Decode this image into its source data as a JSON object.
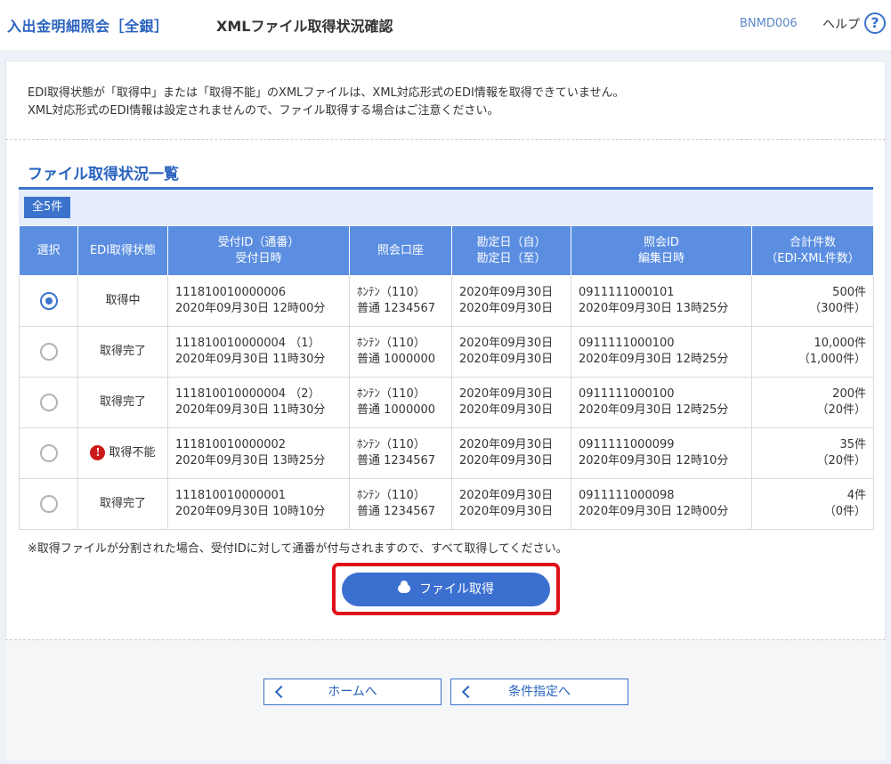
{
  "header": {
    "breadcrumb": "入出金明細照会［全銀］",
    "title": "XMLファイル取得状況確認",
    "screen_id": "BNMD006",
    "help_label": "ヘルプ",
    "help_icon": "?"
  },
  "notice": {
    "line1": "EDI取得状態が「取得中」または「取得不能」のXMLファイルは、XML対応形式のEDI情報を取得できていません。",
    "line2": "XML対応形式のEDI情報は設定されませんので、ファイル取得する場合はご注意ください。"
  },
  "section": {
    "title": "ファイル取得状況一覧",
    "count": "全5件"
  },
  "table": {
    "headers": [
      {
        "l1": "選択",
        "l2": ""
      },
      {
        "l1": "EDI取得状態",
        "l2": ""
      },
      {
        "l1": "受付ID（通番）",
        "l2": "受付日時"
      },
      {
        "l1": "照会口座",
        "l2": ""
      },
      {
        "l1": "勘定日（自）",
        "l2": "勘定日（至）"
      },
      {
        "l1": "照会ID",
        "l2": "編集日時"
      },
      {
        "l1": "合計件数",
        "l2": "（EDI-XML件数）"
      }
    ],
    "rows": [
      {
        "selected": true,
        "status": "取得中",
        "status_error": false,
        "receipt_id": "111810010000006",
        "receipt_dt": "2020年09月30日 12時00分",
        "branch": "ﾎﾝﾃﾝ（110）",
        "account": "普通 1234567",
        "date_from": "2020年09月30日",
        "date_to": "2020年09月30日",
        "inquiry_id": "0911111000101",
        "edit_dt": "2020年09月30日 13時25分",
        "total": "500件",
        "xml_count": "（300件）"
      },
      {
        "selected": false,
        "status": "取得完了",
        "status_error": false,
        "receipt_id": "111810010000004 （1）",
        "receipt_dt": "2020年09月30日 11時30分",
        "branch": "ﾎﾝﾃﾝ（110）",
        "account": "普通 1000000",
        "date_from": "2020年09月30日",
        "date_to": "2020年09月30日",
        "inquiry_id": "0911111000100",
        "edit_dt": "2020年09月30日 12時25分",
        "total": "10,000件",
        "xml_count": "（1,000件）"
      },
      {
        "selected": false,
        "status": "取得完了",
        "status_error": false,
        "receipt_id": "111810010000004 （2）",
        "receipt_dt": "2020年09月30日 11時30分",
        "branch": "ﾎﾝﾃﾝ（110）",
        "account": "普通 1000000",
        "date_from": "2020年09月30日",
        "date_to": "2020年09月30日",
        "inquiry_id": "0911111000100",
        "edit_dt": "2020年09月30日 12時25分",
        "total": "200件",
        "xml_count": "（20件）"
      },
      {
        "selected": false,
        "status": "取得不能",
        "status_error": true,
        "receipt_id": "111810010000002",
        "receipt_dt": "2020年09月30日 13時25分",
        "branch": "ﾎﾝﾃﾝ（110）",
        "account": "普通 1234567",
        "date_from": "2020年09月30日",
        "date_to": "2020年09月30日",
        "inquiry_id": "0911111000099",
        "edit_dt": "2020年09月30日 12時10分",
        "total": "35件",
        "xml_count": "（20件）"
      },
      {
        "selected": false,
        "status": "取得完了",
        "status_error": false,
        "receipt_id": "111810010000001",
        "receipt_dt": "2020年09月30日 10時10分",
        "branch": "ﾎﾝﾃﾝ（110）",
        "account": "普通 1234567",
        "date_from": "2020年09月30日",
        "date_to": "2020年09月30日",
        "inquiry_id": "0911111000098",
        "edit_dt": "2020年09月30日 12時00分",
        "total": "4件",
        "xml_count": "（0件）"
      }
    ]
  },
  "footnote": "※取得ファイルが分割された場合、受付IDに対して通番が付与されますので、すべて取得してください。",
  "actions": {
    "fetch_label": "ファイル取得",
    "home_label": "ホームへ",
    "conditions_label": "条件指定へ"
  },
  "icons": {
    "error": "!",
    "help": "question-circle-icon",
    "cloud": "cloud-download-icon",
    "back": "chevron-left-icon"
  },
  "colors": {
    "accent": "#3b73cc",
    "table_header": "#5b8ee0",
    "highlight": "#e0101a",
    "error": "#cc1a1a"
  }
}
